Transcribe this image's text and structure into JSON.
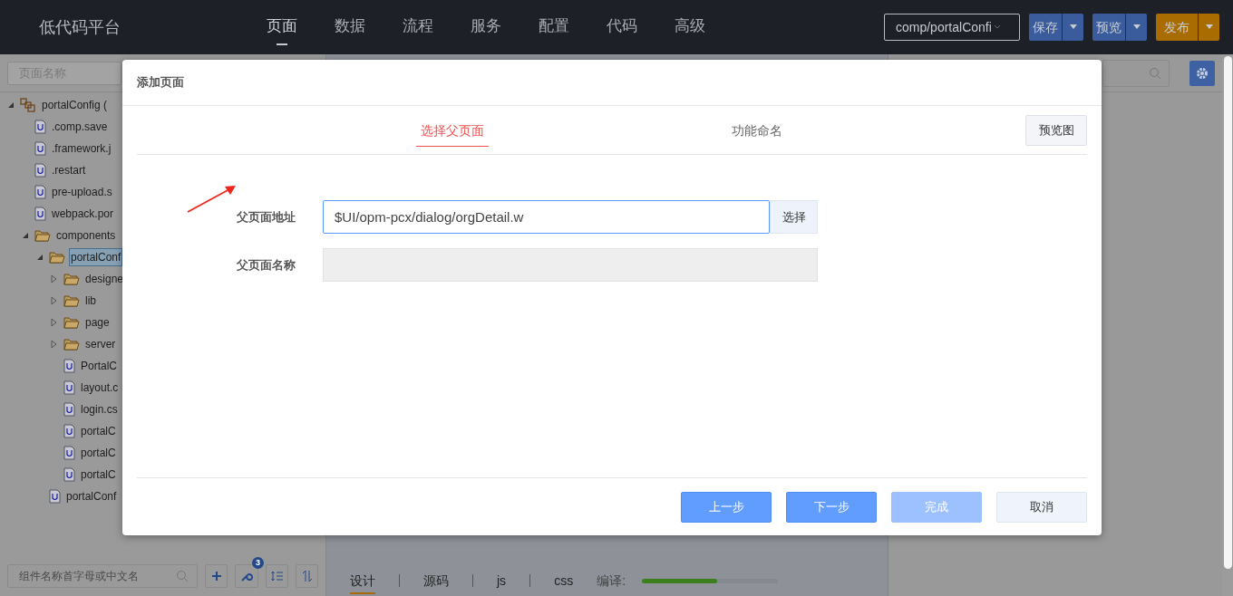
{
  "header": {
    "logo": "低代码平台",
    "nav": [
      {
        "label": "页面",
        "selected": true
      },
      {
        "label": "数据",
        "selected": false
      },
      {
        "label": "流程",
        "selected": false
      },
      {
        "label": "服务",
        "selected": false
      },
      {
        "label": "配置",
        "selected": false
      },
      {
        "label": "代码",
        "selected": false
      },
      {
        "label": "高级",
        "selected": false
      }
    ],
    "path_select": {
      "value": "comp/portalConfi"
    },
    "actions": [
      {
        "label": "保存",
        "kind": "primary"
      },
      {
        "label": "预览",
        "kind": "primary"
      },
      {
        "label": "发布",
        "kind": "publish"
      }
    ]
  },
  "left_panel": {
    "search": {
      "placeholder": "页面名称"
    },
    "tree": [
      {
        "label": "portalConfig (",
        "kind": "project",
        "expanded": true,
        "selected": false,
        "children": [
          {
            "label": ".comp.save",
            "kind": "file",
            "selected": false
          },
          {
            "label": ".framework.j",
            "kind": "file",
            "selected": false
          },
          {
            "label": ".restart",
            "kind": "file",
            "selected": false
          },
          {
            "label": "pre-upload.s",
            "kind": "file",
            "selected": false
          },
          {
            "label": "webpack.por",
            "kind": "file",
            "selected": false
          },
          {
            "label": "components",
            "kind": "folder",
            "expanded": true,
            "selected": false,
            "children": [
              {
                "label": "portalConf",
                "kind": "folder",
                "expanded": true,
                "selected": true,
                "children": [
                  {
                    "label": "designe",
                    "kind": "folder",
                    "expanded": false,
                    "selected": false
                  },
                  {
                    "label": "lib",
                    "kind": "folder",
                    "expanded": false,
                    "selected": false
                  },
                  {
                    "label": "page",
                    "kind": "folder",
                    "expanded": false,
                    "selected": false
                  },
                  {
                    "label": "server",
                    "kind": "folder",
                    "expanded": false,
                    "selected": false
                  },
                  {
                    "label": "PortalC",
                    "kind": "file",
                    "selected": false
                  },
                  {
                    "label": "layout.c",
                    "kind": "file",
                    "selected": false
                  },
                  {
                    "label": "login.cs",
                    "kind": "file",
                    "selected": false
                  },
                  {
                    "label": "portalC",
                    "kind": "file",
                    "selected": false
                  },
                  {
                    "label": "portalC",
                    "kind": "file",
                    "selected": false
                  },
                  {
                    "label": "portalC",
                    "kind": "file",
                    "selected": false
                  }
                ]
              },
              {
                "label": "portalConf",
                "kind": "file",
                "selected": false
              }
            ]
          }
        ]
      }
    ],
    "component_search": {
      "placeholder": "组件名称首字母或中文名"
    },
    "tool_badge": "3"
  },
  "editor_tabs": [
    {
      "label": "设计",
      "selected": true
    },
    {
      "label": "源码",
      "selected": false
    },
    {
      "label": "js",
      "selected": false
    },
    {
      "label": "css",
      "selected": false
    }
  ],
  "compile": {
    "label": "编译:",
    "level": 0.55
  },
  "dialog": {
    "title": "添加页面",
    "steps": [
      {
        "label": "选择父页面",
        "selected": true
      },
      {
        "label": "功能命名",
        "selected": false
      }
    ],
    "preview_button": "预览图",
    "fields": [
      {
        "label": "父页面地址",
        "value": "$UI/opm-pcx/dialog/orgDetail.w",
        "button": "选择",
        "disabled": false
      },
      {
        "label": "父页面名称",
        "disabled": true
      }
    ],
    "buttons": [
      {
        "label": "上一步",
        "kind": "primary",
        "disabled": false
      },
      {
        "label": "下一步",
        "kind": "primary",
        "disabled": false
      },
      {
        "label": "完成",
        "kind": "primary",
        "disabled": true
      },
      {
        "label": "取消",
        "kind": "default",
        "disabled": false
      }
    ]
  }
}
